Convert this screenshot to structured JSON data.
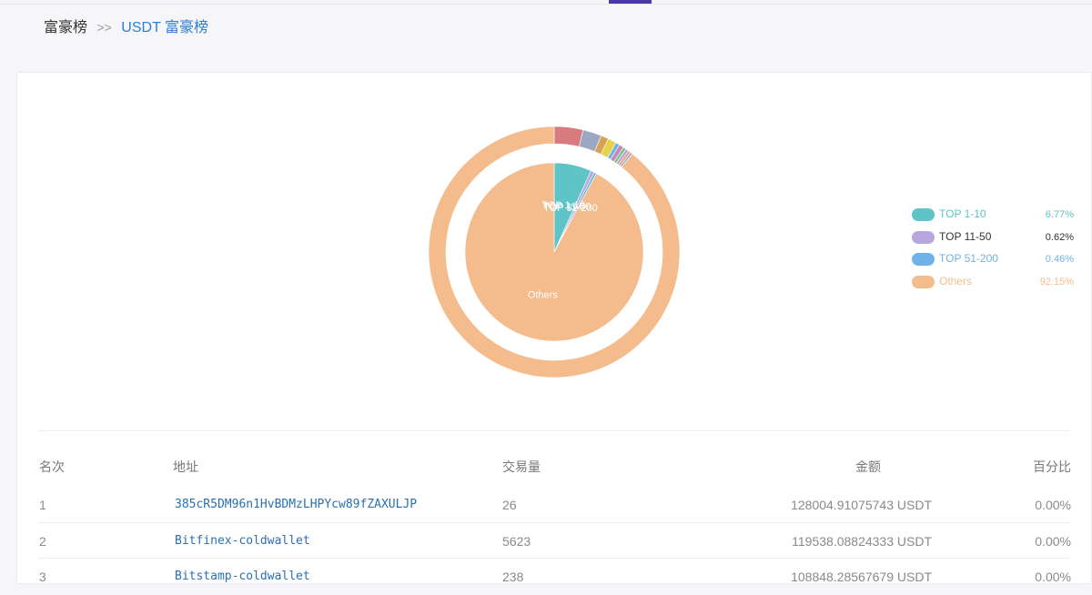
{
  "breadcrumb": {
    "root": "富豪榜",
    "separator": ">>",
    "current": "USDT 富豪榜"
  },
  "colors": {
    "top_1_10": "#5ec4c6",
    "top_11_50": "#b8a6dd",
    "top_51_200": "#6fb2e8",
    "others": "#f4bc8c",
    "link": "#2d7fd3",
    "nav_active": "#4a3aa8"
  },
  "chart_data": {
    "type": "pie",
    "inner_ring_labels": [
      "TOP 1-10",
      "TOP 11-50",
      "TOP 51-200",
      "Others"
    ],
    "legend_position": "right",
    "series": [
      {
        "ring": "inner",
        "slices": [
          {
            "label": "TOP 1-10",
            "value": 6.77,
            "color": "#5ec4c6"
          },
          {
            "label": "TOP 11-50",
            "value": 0.62,
            "color": "#b8a6dd"
          },
          {
            "label": "TOP 51-200",
            "value": 0.46,
            "color": "#6fb2e8"
          },
          {
            "label": "Others",
            "value": 92.15,
            "color": "#f4bc8c"
          }
        ]
      },
      {
        "ring": "outer",
        "slices": [
          {
            "value": 3.7,
            "color": "#d97a7e"
          },
          {
            "value": 2.4,
            "color": "#9aa8c4"
          },
          {
            "value": 1.0,
            "color": "#d8a256"
          },
          {
            "value": 1.1,
            "color": "#e6d24c"
          },
          {
            "value": 0.5,
            "color": "#6fb2e8"
          },
          {
            "value": 0.6,
            "color": "#c58bb8"
          },
          {
            "value": 0.4,
            "color": "#7fbf88"
          },
          {
            "value": 0.4,
            "color": "#b8a6dd"
          },
          {
            "value": 0.3,
            "color": "#e89a6c"
          },
          {
            "value": 0.3,
            "color": "#9fb0c8"
          },
          {
            "value": 89.3,
            "color": "#f4bc8c"
          }
        ]
      }
    ]
  },
  "legend": [
    {
      "label": "TOP 1-10",
      "value": "6.77%",
      "color": "#5ec4c6",
      "text_color": "#5ec4c6"
    },
    {
      "label": "TOP 11-50",
      "value": "0.62%",
      "color": "#b8a6dd",
      "text_color": "#333333"
    },
    {
      "label": "TOP 51-200",
      "value": "0.46%",
      "color": "#6fb2e8",
      "text_color": "#6fb2e8"
    },
    {
      "label": "Others",
      "value": "92.15%",
      "color": "#f4bc8c",
      "text_color": "#f4bc8c"
    }
  ],
  "table": {
    "headers": {
      "rank": "名次",
      "address": "地址",
      "volume": "交易量",
      "amount": "金额",
      "percent": "百分比"
    },
    "rows": [
      {
        "rank": "1",
        "address": "385cR5DM96n1HvBDMzLHPYcw89fZAXULJP",
        "volume": "26",
        "amount": "128004.91075743 USDT",
        "percent": "0.00%"
      },
      {
        "rank": "2",
        "address": "Bitfinex-coldwallet",
        "volume": "5623",
        "amount": "119538.08824333 USDT",
        "percent": "0.00%"
      },
      {
        "rank": "3",
        "address": "Bitstamp-coldwallet",
        "volume": "238",
        "amount": "108848.28567679 USDT",
        "percent": "0.00%"
      }
    ]
  }
}
